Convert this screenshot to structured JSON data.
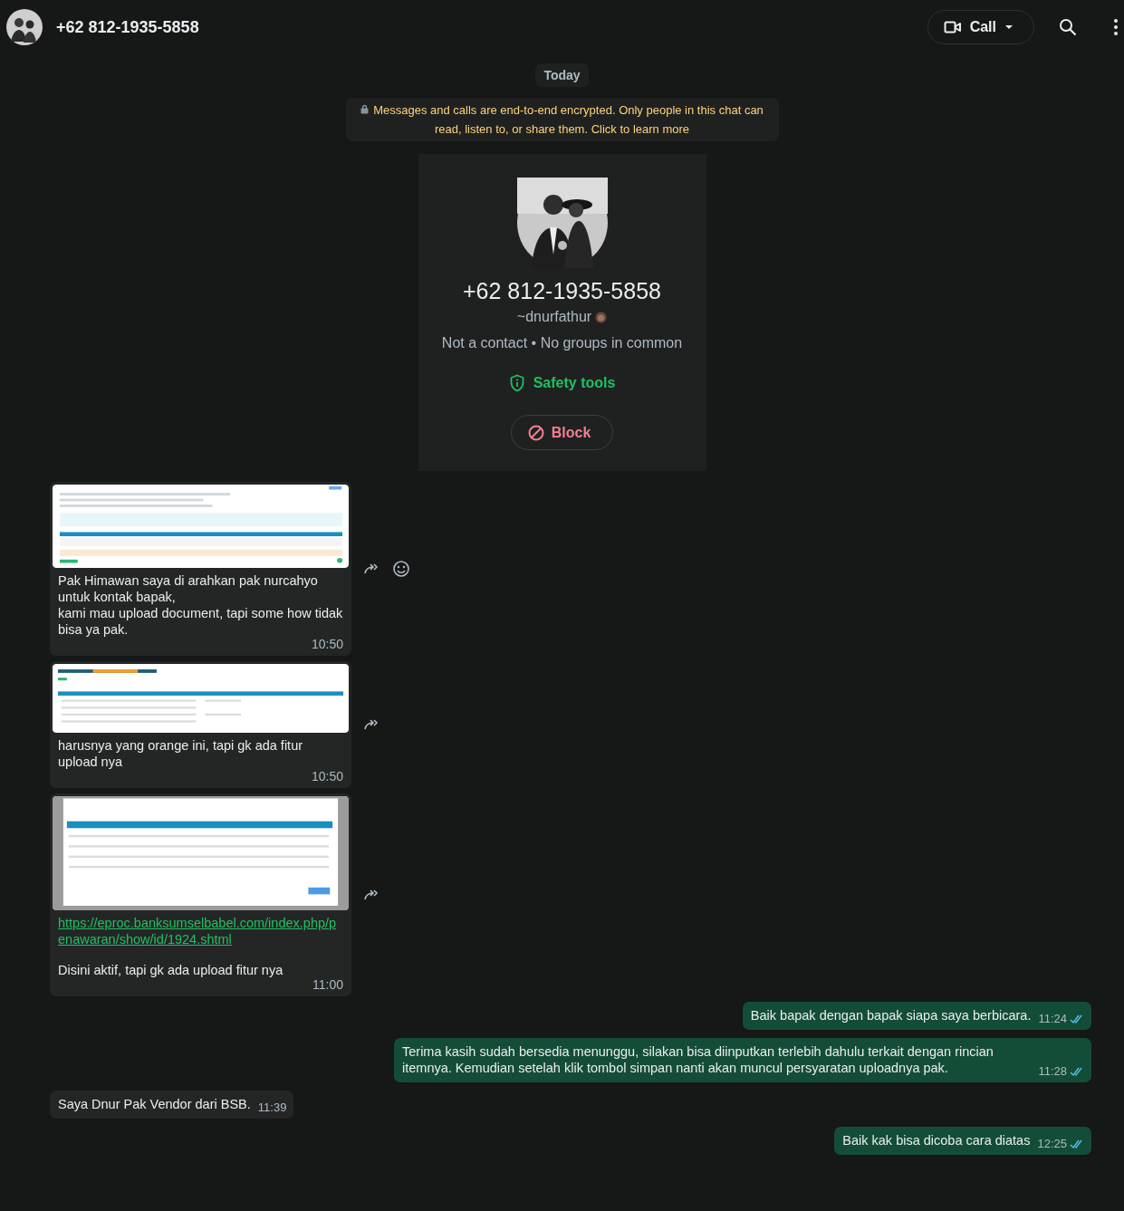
{
  "header": {
    "title": "+62 812-1935-5858",
    "call_label": "Call"
  },
  "date_chip": "Today",
  "encryption_notice": "Messages and calls are end-to-end encrypted. Only people in this chat can read, listen to, or share them. Click to learn more",
  "contact_card": {
    "phone": "+62 812-1935-5858",
    "username": "~dnurfathur",
    "status": "Not a contact • No groups in common",
    "safety_label": "Safety tools",
    "block_label": "Block"
  },
  "messages": [
    {
      "kind": "incoming",
      "text": "Pak Himawan saya di arahkan pak nurcahyo untuk kontak bapak,\nkami mau upload document, tapi some how tidak bisa ya pak.",
      "time": "10:50",
      "react": true
    },
    {
      "kind": "incoming",
      "text": "harusnya yang orange ini, tapi gk ada fitur upload nya",
      "time": "10:50"
    },
    {
      "kind": "incoming",
      "link": "https://eproc.banksumselbabel.com/index.php/penawaran/show/id/1924.shtml",
      "text": "Disini aktif, tapi gk ada upload fitur nya",
      "time": "11:00"
    },
    {
      "kind": "outgoing",
      "text": "Baik bapak dengan bapak siapa saya berbicara.",
      "time": "11:24",
      "read": true
    },
    {
      "kind": "outgoing",
      "text": "Terima kasih sudah bersedia menunggu, silakan bisa diinputkan terlebih dahulu terkait dengan rincian itemnya. Kemudian setelah klik tombol simpan nanti akan muncul persyaratan uploadnya pak.",
      "time": "11:28",
      "read": true
    },
    {
      "kind": "incoming",
      "text": "Saya Dnur Pak Vendor dari BSB.",
      "time": "11:39"
    },
    {
      "kind": "outgoing",
      "text": "Baik kak bisa dicoba cara diatas",
      "time": "12:25",
      "read": true
    }
  ]
}
